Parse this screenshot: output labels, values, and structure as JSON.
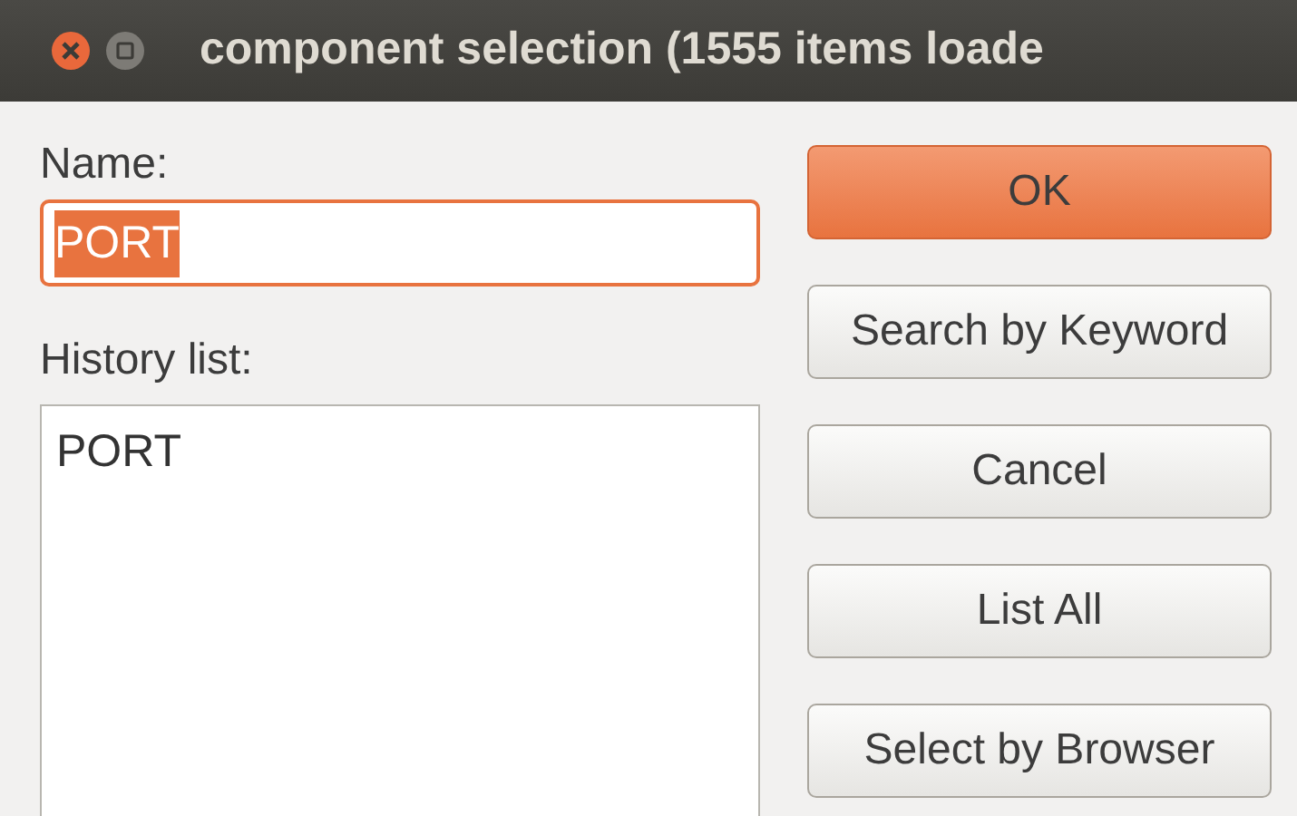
{
  "window": {
    "title": "component selection (1555 items loade"
  },
  "name_field": {
    "label": "Name:",
    "value": "PORT",
    "text_selected": true
  },
  "history": {
    "label": "History list:",
    "items": [
      {
        "label": "PORT",
        "selected": false
      }
    ]
  },
  "buttons": [
    {
      "label": "OK",
      "default": true
    },
    {
      "label": "Search by Keyword",
      "default": false
    },
    {
      "label": "Cancel",
      "default": false
    },
    {
      "label": "List All",
      "default": false
    },
    {
      "label": "Select by Browser",
      "default": false
    }
  ]
}
